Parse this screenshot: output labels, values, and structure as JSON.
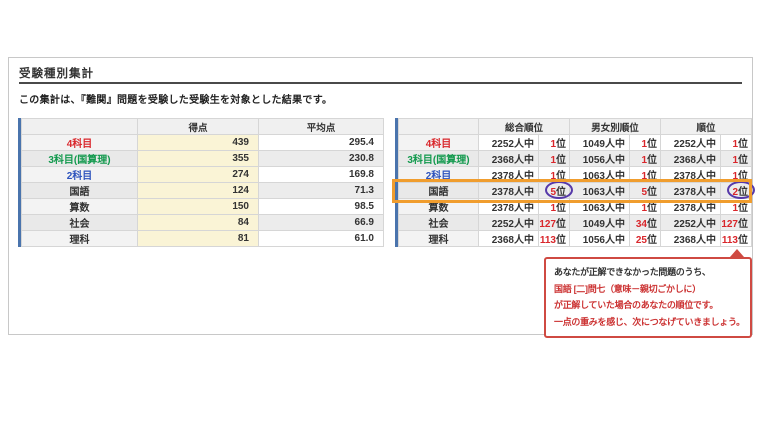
{
  "page": {
    "title": "受験種別集計",
    "description": "この集計は、『難関』問題を受験した受験生を対象とした結果です。"
  },
  "colors": {
    "accent_bar_blue": "#4a74ad",
    "score_cell_yellow": "#faf4d6",
    "label_red": "#d9262b",
    "label_green": "#12994d",
    "label_blue": "#2d53bd",
    "rank_number_red": "#d9262b",
    "row_highlight_orange": "#f09d2e",
    "circle_purple": "#5639a9",
    "callout_red": "#cc3333"
  },
  "score_table": {
    "headers": {
      "score": "得点",
      "average": "平均点"
    },
    "rows": [
      {
        "label": "4科目",
        "score": "439",
        "average": "295.4"
      },
      {
        "label": "3科目(国算理)",
        "score": "355",
        "average": "230.8"
      },
      {
        "label": "2科目",
        "score": "274",
        "average": "169.8"
      },
      {
        "label": "国語",
        "score": "124",
        "average": "71.3"
      },
      {
        "label": "算数",
        "score": "150",
        "average": "98.5"
      },
      {
        "label": "社会",
        "score": "84",
        "average": "66.9"
      },
      {
        "label": "理科",
        "score": "81",
        "average": "61.0"
      }
    ]
  },
  "rank_table": {
    "headers": {
      "overall": "総合順位",
      "by_gender": "男女別順位",
      "rank": "順位"
    },
    "suffix": "位",
    "rows": [
      {
        "label": "4科目",
        "groups": [
          {
            "total": "2252人中",
            "rank": "1"
          },
          {
            "total": "1049人中",
            "rank": "1"
          },
          {
            "total": "2252人中",
            "rank": "1"
          }
        ]
      },
      {
        "label": "3科目(国算理)",
        "groups": [
          {
            "total": "2368人中",
            "rank": "1"
          },
          {
            "total": "1056人中",
            "rank": "1"
          },
          {
            "total": "2368人中",
            "rank": "1"
          }
        ]
      },
      {
        "label": "2科目",
        "groups": [
          {
            "total": "2378人中",
            "rank": "1"
          },
          {
            "total": "1063人中",
            "rank": "1"
          },
          {
            "total": "2378人中",
            "rank": "1"
          }
        ]
      },
      {
        "label": "国語",
        "groups": [
          {
            "total": "2378人中",
            "rank": "5"
          },
          {
            "total": "1063人中",
            "rank": "5"
          },
          {
            "total": "2378人中",
            "rank": "2"
          }
        ]
      },
      {
        "label": "算数",
        "groups": [
          {
            "total": "2378人中",
            "rank": "1"
          },
          {
            "total": "1063人中",
            "rank": "1"
          },
          {
            "total": "2378人中",
            "rank": "1"
          }
        ]
      },
      {
        "label": "社会",
        "groups": [
          {
            "total": "2252人中",
            "rank": "127"
          },
          {
            "total": "1049人中",
            "rank": "34"
          },
          {
            "total": "2252人中",
            "rank": "127"
          }
        ]
      },
      {
        "label": "理科",
        "groups": [
          {
            "total": "2368人中",
            "rank": "113"
          },
          {
            "total": "1056人中",
            "rank": "25"
          },
          {
            "total": "2368人中",
            "rank": "113"
          }
        ]
      }
    ],
    "highlighted_row": "国語"
  },
  "callout": {
    "lines": [
      "あなたが正解できなかった問題のうち、",
      "国語 [二]問七（意味－親切ごかしに）",
      "が正解していた場合のあなたの順位です。",
      "一点の重みを感じ、次につなげていきましょう。"
    ]
  }
}
